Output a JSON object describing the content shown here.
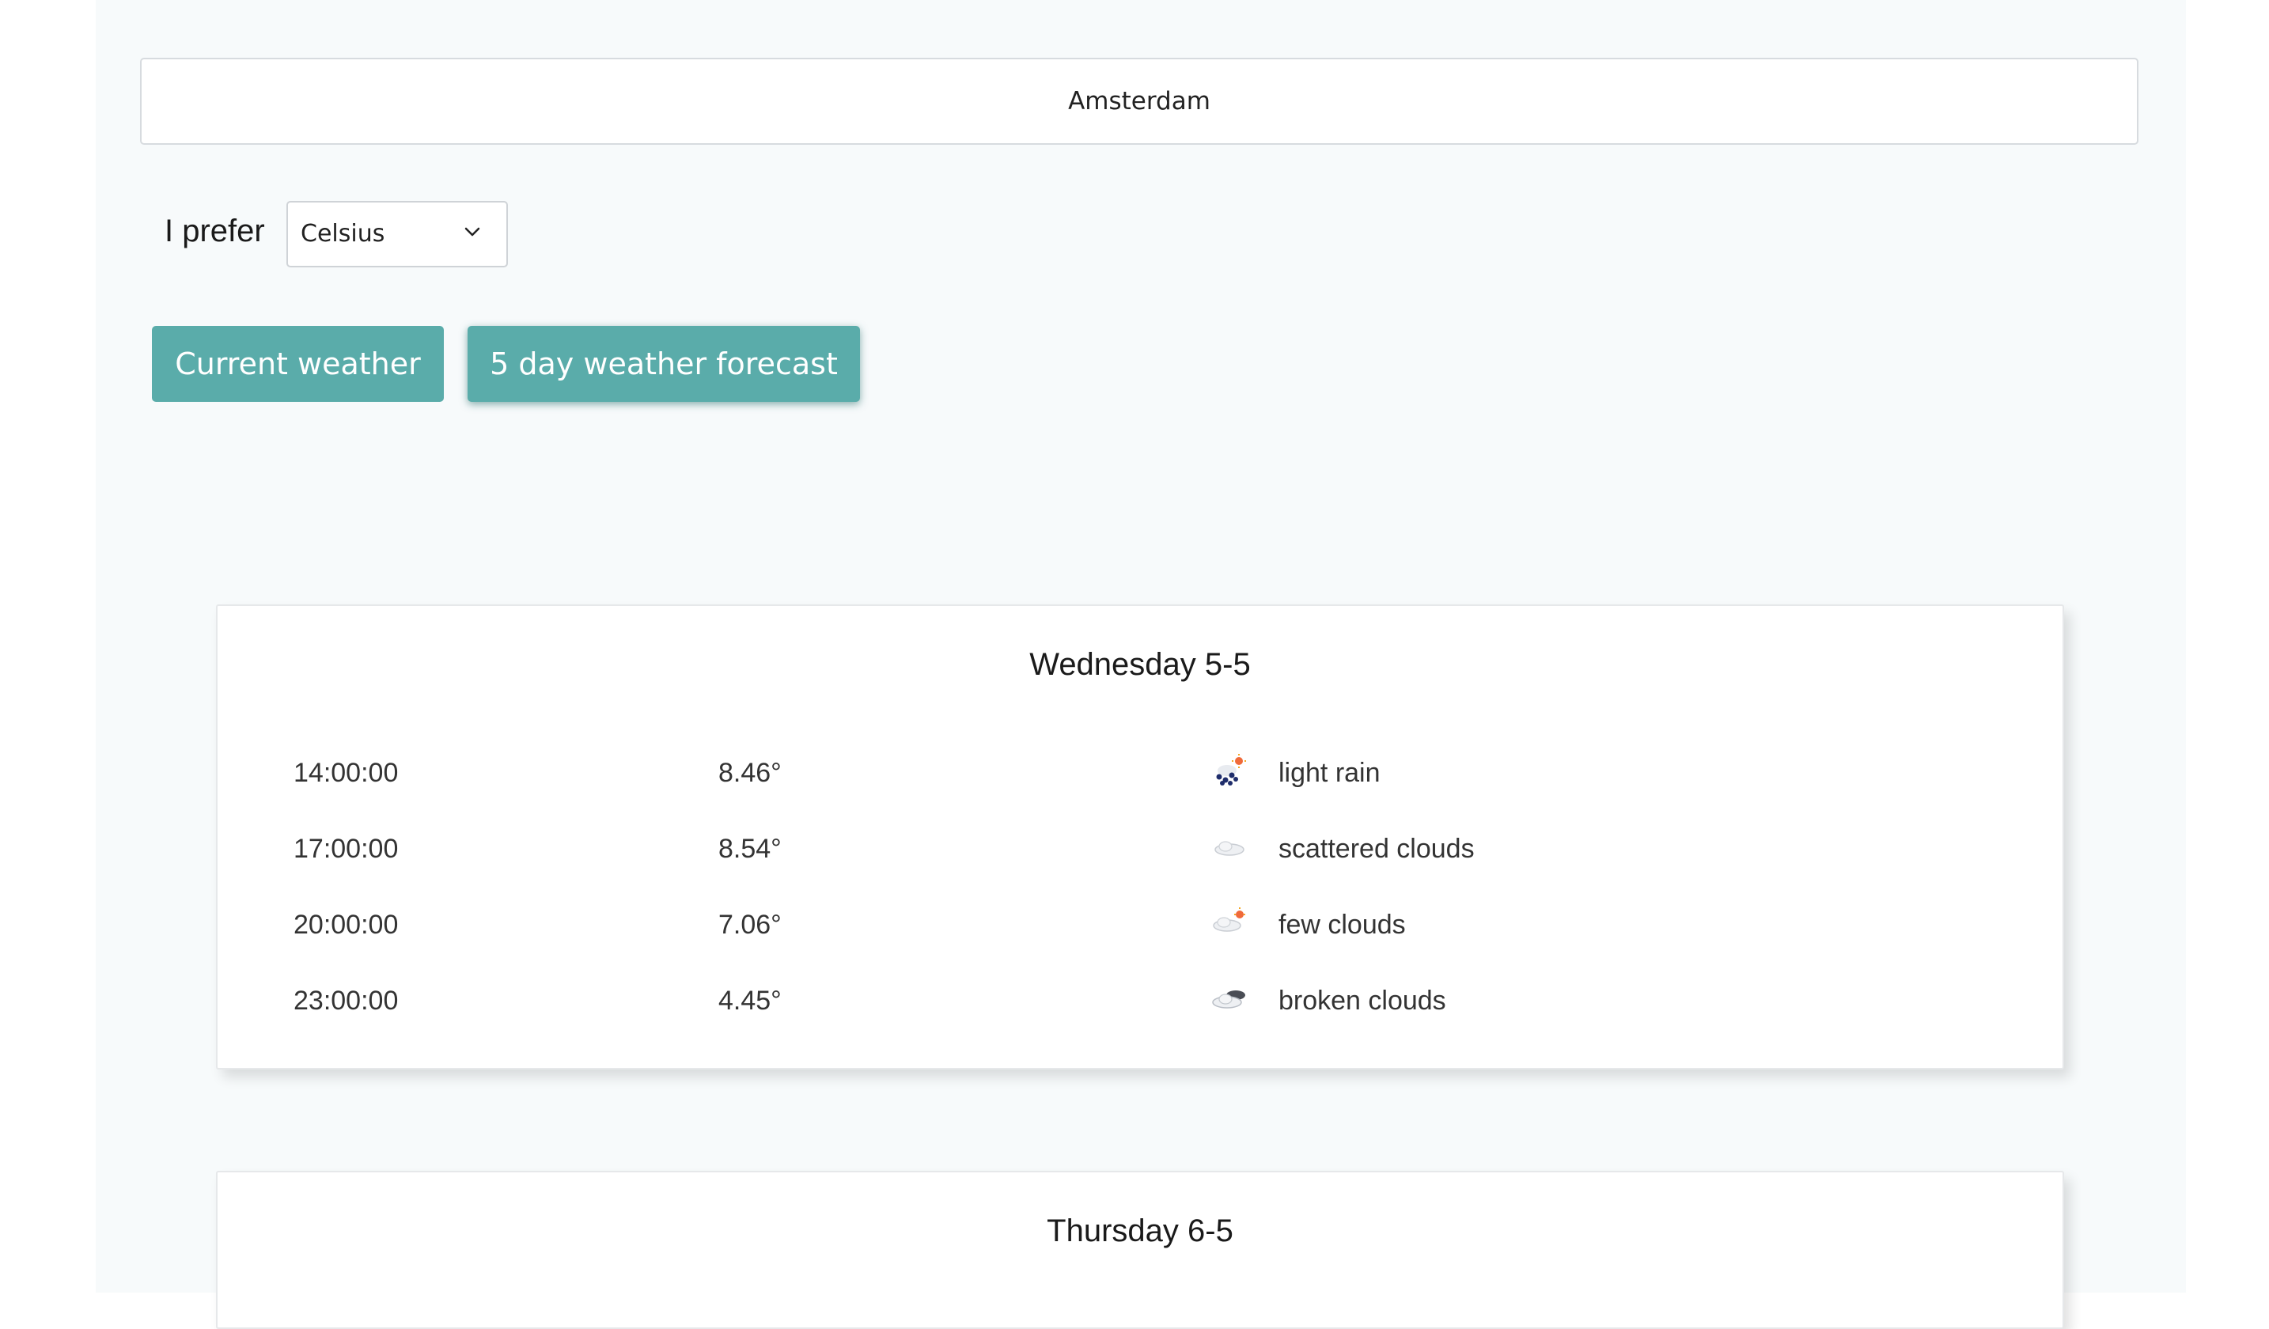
{
  "search": {
    "value": "Amsterdam"
  },
  "preferences": {
    "label": "I prefer",
    "unit_selected": "Celsius"
  },
  "buttons": {
    "current": "Current weather",
    "forecast": "5 day weather forecast"
  },
  "days": [
    {
      "title": "Wednesday 5-5",
      "rows": [
        {
          "time": "14:00:00",
          "temp": "8.46°",
          "icon": "light-rain-icon",
          "desc": "light rain"
        },
        {
          "time": "17:00:00",
          "temp": "8.54°",
          "icon": "scattered-clouds-icon",
          "desc": "scattered clouds"
        },
        {
          "time": "20:00:00",
          "temp": "7.06°",
          "icon": "few-clouds-icon",
          "desc": "few clouds"
        },
        {
          "time": "23:00:00",
          "temp": "4.45°",
          "icon": "broken-clouds-icon",
          "desc": "broken clouds"
        }
      ]
    },
    {
      "title": "Thursday 6-5",
      "rows": []
    }
  ],
  "colors": {
    "accent": "#5aacaa",
    "background": "#f7fafb"
  }
}
